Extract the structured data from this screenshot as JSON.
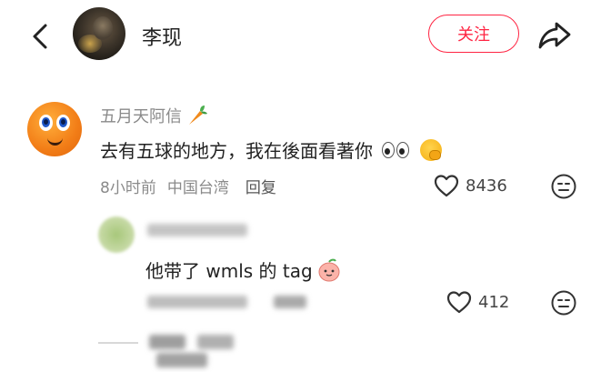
{
  "header": {
    "name": "李现",
    "follow_label": "关注"
  },
  "comment": {
    "username": "五月天阿信",
    "text": "去有五球的地方，我在後面看著你",
    "time": "8小时前",
    "location": "中国台湾",
    "reply_label": "回复",
    "likes": "8436"
  },
  "sub_comment": {
    "text": "他带了 wmls 的 tag",
    "likes": "412"
  },
  "colors": {
    "accent": "#ff2442",
    "muted_text": "#8a8a8a"
  },
  "icons": [
    "back-icon",
    "share-icon",
    "carrot-icon",
    "eyes-emoji",
    "hush-emoji",
    "heart-icon",
    "meh-face-icon",
    "peach-emoji"
  ]
}
